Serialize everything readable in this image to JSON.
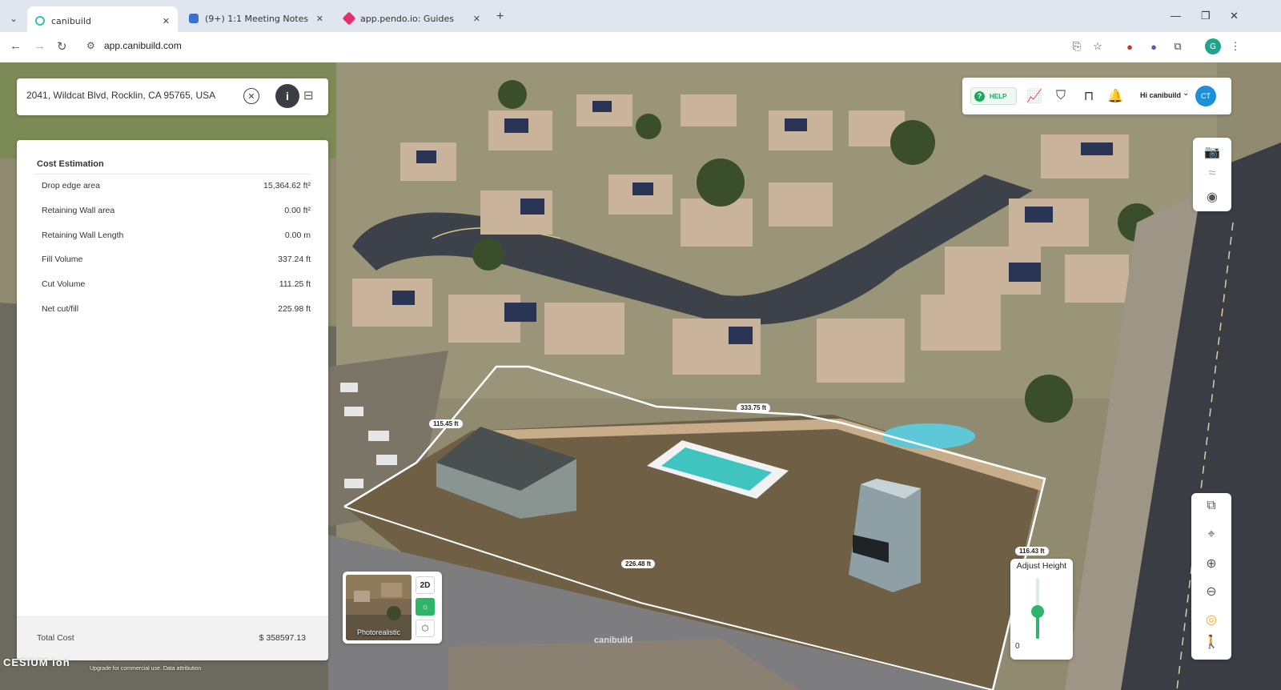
{
  "browser": {
    "tabs": [
      {
        "title": "canibuild",
        "active": true
      },
      {
        "title": "(9+) 1:1 Meeting Notes",
        "active": false
      },
      {
        "title": "app.pendo.io: Guides",
        "active": false
      }
    ],
    "url": "app.canibuild.com",
    "profile_initial": "G"
  },
  "search": {
    "address": "2041, Wildcat Blvd, Rocklin, CA 95765, USA"
  },
  "cost_estimation": {
    "title": "Cost Estimation",
    "rows": [
      {
        "label": "Drop edge area",
        "value": "15,364.62 ft²"
      },
      {
        "label": "Retaining Wall area",
        "value": "0.00 ft²"
      },
      {
        "label": "Retaining Wall Length",
        "value": "0.00 m"
      },
      {
        "label": "Fill Volume",
        "value": "337.24 ft"
      },
      {
        "label": "Cut Volume",
        "value": "111.25 ft"
      },
      {
        "label": "Net cut/fill",
        "value": "225.98 ft"
      }
    ],
    "total_label": "Total Cost",
    "total_value": "$ 358597.13"
  },
  "toolbar": {
    "help_label": "HELP",
    "user_greeting": "Hi canibuild",
    "user_initials": "CT"
  },
  "map_style": {
    "thumb_label": "Photorealistic",
    "mode_2d": "2D"
  },
  "adjust_height": {
    "label": "Adjust Height",
    "min_label": "0",
    "level": 0.45
  },
  "dimensions": {
    "left": "115.45 ft",
    "top": "333.75 ft",
    "bottom": "226.48 ft",
    "right": "116.43 ft"
  },
  "attribution": {
    "logo": "CESIUM ion",
    "note": "Upgrade for commercial use. Data attribution",
    "watermark": "canibuild"
  },
  "colors": {
    "accent_green": "#2fb56a",
    "avatar_blue": "#1b8fd8",
    "pool": "#3fc4c0"
  }
}
